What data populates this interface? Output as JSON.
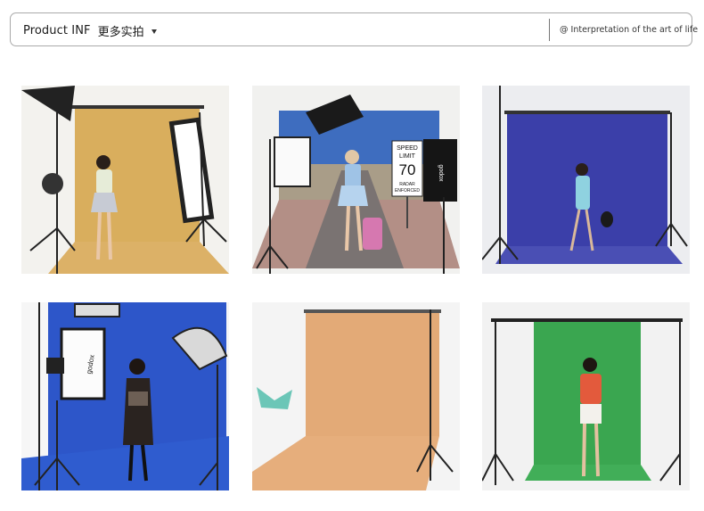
{
  "header": {
    "title": "Product INF",
    "subtitle": "更多实拍",
    "dropdown_icon": "caret-down-icon",
    "tagline": "@ Interpretation of the art of life"
  },
  "photos": [
    {
      "backdrop": "#d9ae5d",
      "wall": "#f2f2f0"
    },
    {
      "backdrop": "#3e6dbf",
      "wall": "#f2f2f0",
      "sign": [
        "SPEED",
        "LIMIT",
        "70",
        "RADAR",
        "ENFORCED"
      ],
      "brand": "godox"
    },
    {
      "backdrop": "#3b3fa9",
      "wall": "#eceef2"
    },
    {
      "backdrop": "#2d56c9",
      "wall": "#f5f5f5",
      "brand": "godox"
    },
    {
      "backdrop": "#e3aa77",
      "wall": "#f4f4f4"
    },
    {
      "backdrop": "#3aa650",
      "wall": "#f2f2f2"
    }
  ]
}
